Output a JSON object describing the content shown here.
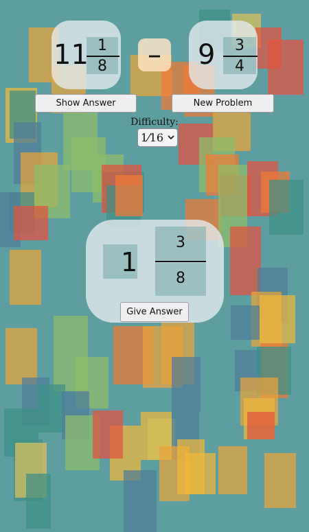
{
  "problem": {
    "left": {
      "whole": "11",
      "numerator": "1",
      "denominator": "8"
    },
    "operator": "–",
    "right": {
      "whole": "9",
      "numerator": "3",
      "denominator": "4"
    }
  },
  "buttons": {
    "show_answer": "Show Answer",
    "new_problem": "New Problem",
    "give_answer": "Give Answer"
  },
  "difficulty": {
    "label": "Difficulty:",
    "selected": "1⁄16"
  },
  "answer": {
    "whole": "1",
    "numerator": "3",
    "denominator": "8"
  },
  "colors": {
    "background": "#5f9ea0",
    "rect_palette": [
      "#e8a33a",
      "#f0b83c",
      "#e2533f",
      "#f07a35",
      "#3f8f86",
      "#8dbd6a",
      "#4f7d98",
      "#d9c25a"
    ]
  }
}
